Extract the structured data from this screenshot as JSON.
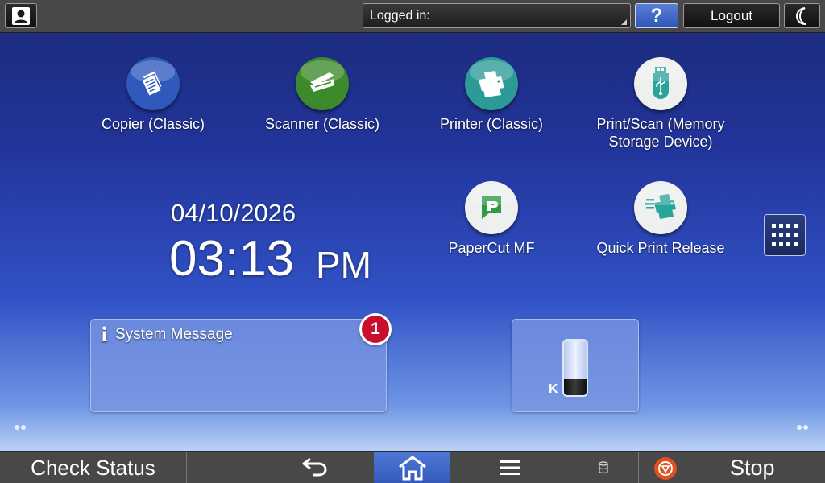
{
  "topbar": {
    "login_label": "Logged in:",
    "help_label": "?",
    "logout_label": "Logout"
  },
  "apps": [
    {
      "label": "Copier (Classic)",
      "icon": "copier-icon",
      "color": "#2f59bd"
    },
    {
      "label": "Scanner (Classic)",
      "icon": "scanner-icon",
      "color": "#3c8a2b"
    },
    {
      "label": "Printer (Classic)",
      "icon": "printer-icon",
      "color": "#2c9a96"
    },
    {
      "label": "Print/Scan (Memory Storage Device)",
      "icon": "usb-icon",
      "color": "#eef0f0"
    },
    {
      "label": "PaperCut MF",
      "icon": "papercut-icon",
      "color": "#eef0f0"
    },
    {
      "label": "Quick Print Release",
      "icon": "quick-print-icon",
      "color": "#eef0f0"
    }
  ],
  "datetime": {
    "date": "04/10/2026",
    "time": "03:13",
    "ampm": "PM"
  },
  "system_message": {
    "title": "System Message",
    "count": "1"
  },
  "toner": {
    "label": "K",
    "level": 0.3
  },
  "bottombar": {
    "check_status": "Check Status",
    "stop": "Stop"
  },
  "colors": {
    "accent": "#3459b9",
    "badge": "#c8102e",
    "stop": "#e2501e"
  }
}
